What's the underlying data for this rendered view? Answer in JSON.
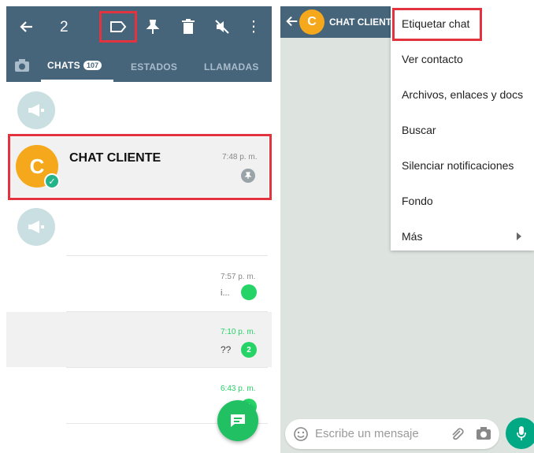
{
  "left": {
    "topbar": {
      "back_icon": "←",
      "selected_count": "2",
      "label_icon": "label-outline",
      "pin_icon": "pin",
      "delete_icon": "trash",
      "mute_icon": "speaker-off",
      "more_icon": "⋮"
    },
    "tabs": {
      "camera_icon": "camera",
      "chats_label": "CHATS",
      "chats_badge": "107",
      "estados_label": "ESTADOS",
      "llamadas_label": "LLAMADAS"
    },
    "highlighted_chat": {
      "avatar_letter": "C",
      "name": "CHAT CLIENTE",
      "time": "7:48 p. m."
    },
    "rows": [
      {
        "time": "7:57 p. m.",
        "preview": "i...",
        "unread": ""
      },
      {
        "time": "7:10 p. m.",
        "preview": "??",
        "unread": "2"
      },
      {
        "time": "6:43 p. m.",
        "preview": "",
        "unread": "1"
      }
    ],
    "colors": {
      "header": "#47657a",
      "accent_green": "#25d366",
      "highlight_red": "#e2343f",
      "avatar_orange": "#f5a81b"
    }
  },
  "right": {
    "title": "CHAT CLIENTE",
    "avatar_letter": "C",
    "menu": [
      {
        "label": "Etiquetar chat"
      },
      {
        "label": "Ver contacto"
      },
      {
        "label": "Archivos, enlaces y docs"
      },
      {
        "label": "Buscar"
      },
      {
        "label": "Silenciar notificaciones"
      },
      {
        "label": "Fondo"
      },
      {
        "label": "Más"
      }
    ],
    "input_placeholder": "Escribe un mensaje"
  }
}
